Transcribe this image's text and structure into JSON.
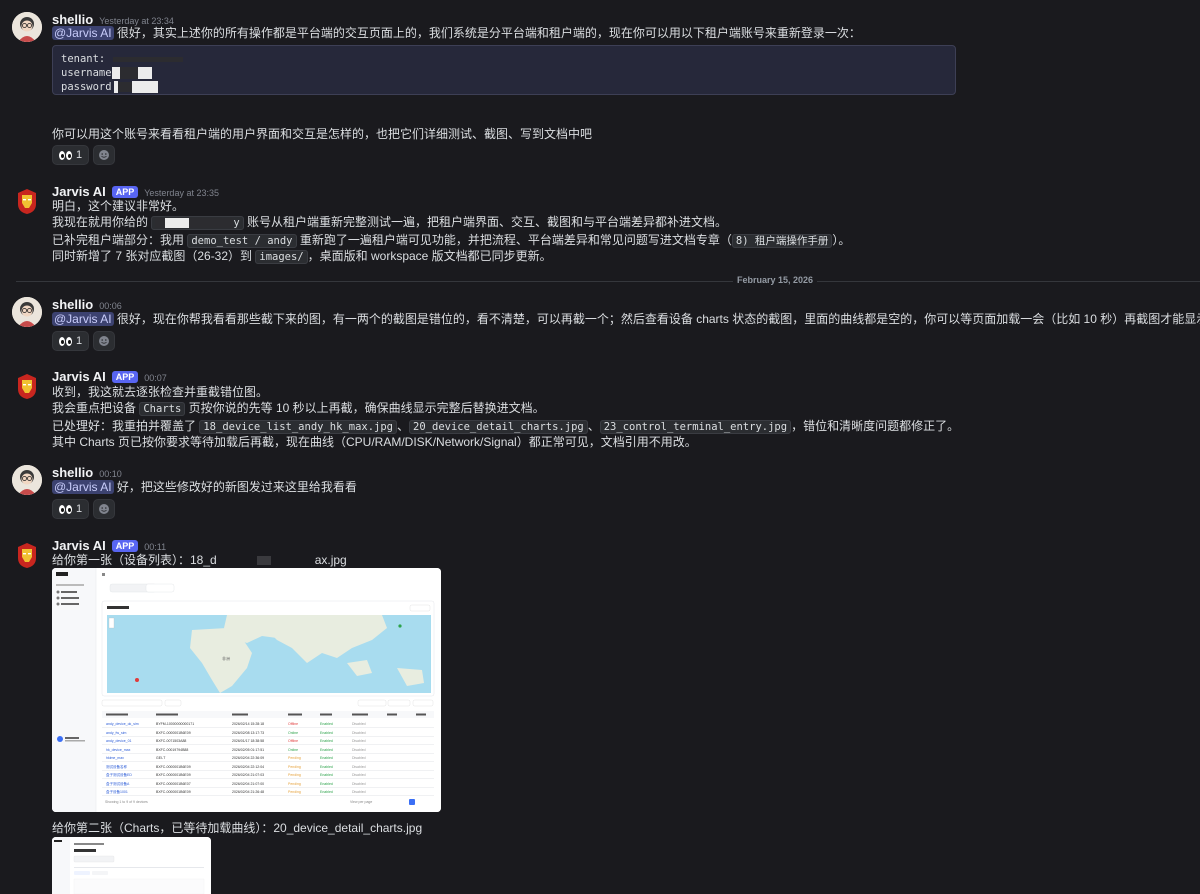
{
  "messages": [
    {
      "author": "shellio",
      "time": "Yesterday at 23:34",
      "mention": "@Jarvis AI",
      "text": "很好，其实上述你的所有操作都是平台端的交互页面上的，我们系统是分平台端和租户端的，现在你可以用以下租户端账号来重新登录一次：",
      "code_lines": [
        "tenant:",
        "username",
        "password"
      ],
      "text2": "你可以用这个账号来看看租户端的用户界面和交互是怎样的，也把它们详细测试、截图、写到文档中吧",
      "reaction_count": "1"
    },
    {
      "author": "Jarvis AI",
      "badge": "APP",
      "time": "Yesterday at 23:35",
      "line1": "明白，这个建议非常好。",
      "line2a": "我现在就用你给的",
      "line2_code": "y",
      "line2b": "账号从租户端重新完整测试一遍，把租户端界面、交互、截图和与平台端差异都补进文档。",
      "line3a": "已补完租户端部分：我用",
      "line3_code": "demo_test / andy",
      "line3b": "重新跑了一遍租户端可见功能，并把流程、平台端差异和常见问题写进文档专章（",
      "line3_code2": "8) 租户端操作手册",
      "line3c": "）。",
      "line4a": "同时新增了 7 张对应截图（26-32）到",
      "line4_code": "images/",
      "line4b": "，桌面版和 workspace 版文档都已同步更新。"
    },
    {
      "author": "shellio",
      "time": "00:06",
      "mention": "@Jarvis AI",
      "text": "很好，现在你帮我看看那些截下来的图，有一两个的截图是错位的，看不清楚，可以再截一个；然后查看设备 charts 状态的截图，里面的曲线都是空的，你可以等页面加载一会（比如 10 秒）再截图才能显示全",
      "reaction_count": "1"
    },
    {
      "author": "Jarvis AI",
      "badge": "APP",
      "time": "00:07",
      "line1": "收到，我这就去逐张检查并重截错位图。",
      "line2a": "我会重点把设备",
      "line2_code": "Charts",
      "line2b": "页按你说的先等 10 秒以上再截，确保曲线显示完整后替换进文档。",
      "line3a": "已处理好：我重拍并覆盖了",
      "line3_code": "18_device_list_andy_hk_max.jpg",
      "line3_sep1": "、",
      "line3_code2": "20_device_detail_charts.jpg",
      "line3_sep2": "、",
      "line3_code3": "23_control_terminal_entry.jpg",
      "line3b": "，错位和清晰度问题都修正了。",
      "line4": "其中 Charts 页已按你要求等待加载后再截，现在曲线（CPU/RAM/DISK/Network/Signal）都正常可见，文档引用不用改。"
    },
    {
      "author": "shellio",
      "time": "00:10",
      "mention": "@Jarvis AI",
      "text": "好，把这些修改好的新图发过来这里给我看看",
      "reaction_count": "1"
    },
    {
      "author": "Jarvis AI",
      "badge": "APP",
      "time": "00:11",
      "line1a": "给你第一张（设备列表）：18_d",
      "line1b": "ax.jpg",
      "line2": "给你第二张（Charts，已等待加载曲线）：20_device_detail_charts.jpg"
    }
  ],
  "date_divider": "February 15, 2026",
  "screenshot": {
    "tabs": [
      "Overview",
      "Devices"
    ],
    "sidebar": [
      "Monitor",
      "Tenant Logs",
      "Tenant Users"
    ],
    "map_title": "Node Map",
    "map_button": "Fit Map",
    "map_label": "非洲",
    "filter_placeholder": "Search by node name or serial number...",
    "search_button": "Search",
    "status_filter": "All Status",
    "refresh": "Refresh",
    "columns": [
      "Device Name",
      "Serial Number",
      "Last Online",
      "Node Status",
      "Enabled",
      "Proxy Status",
      "Control",
      "Action"
    ],
    "rows": [
      [
        "andy_device_ok_sim",
        "BYFM-10000000000171",
        "2026/02/14 15:28:18",
        "Offline",
        "Enabled",
        "Disabled"
      ],
      [
        "andy_fw_sim",
        "BXFC-0000001B6E09",
        "2026/02/08 13:17:73",
        "Online",
        "Enabled",
        "Disabled"
      ],
      [
        "andy_device_01",
        "BXFC-0071503A88",
        "2026/01/17 18:38:58",
        "Offline",
        "Enabled",
        "Disabled"
      ],
      [
        "hk_device_max",
        "BXFC-00019794B88",
        "2026/02/05 01:17:51",
        "Online",
        "Enabled",
        "Disabled"
      ],
      [
        "hklme_max",
        "GEI-T",
        "2026/02/04 22:36:09",
        "Pending",
        "Enabled",
        "Disabled"
      ],
      [
        "测试设备名称",
        "BXFC-0000001B6E09",
        "2026/02/04 22:12:04",
        "Pending",
        "Enabled",
        "Disabled"
      ],
      [
        "盒子测试设备ED",
        "BXFC-0000001B6E09",
        "2026/02/04 21:07:03",
        "Pending",
        "Enabled",
        "Disabled"
      ],
      [
        "盒子测试设备A",
        "BXFC-0000001B6E07",
        "2026/02/04 21:07:00",
        "Pending",
        "Enabled",
        "Disabled"
      ],
      [
        "盒子设备1001",
        "BXFC-0000001B6E09",
        "2026/02/04 21:26:48",
        "Pending",
        "Enabled",
        "Disabled"
      ]
    ],
    "footer": "Showing 1 to 9 of 9 devices",
    "per_page": "View per page",
    "page": "1"
  }
}
